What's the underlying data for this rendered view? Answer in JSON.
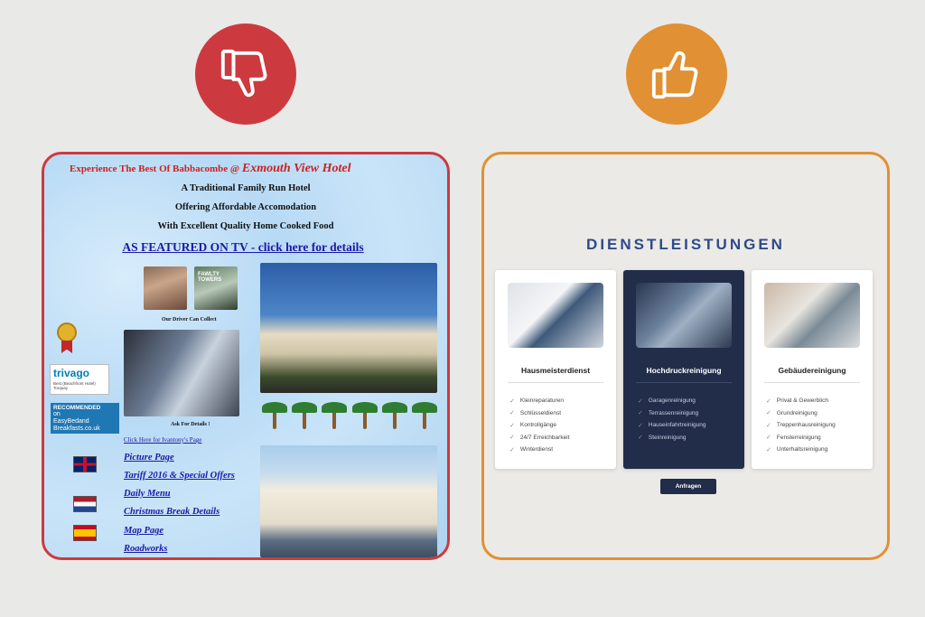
{
  "colors": {
    "bad": "#cc3a3f",
    "good": "#e19033",
    "old_link": "#1a1aa8",
    "new_title": "#2e4a8a",
    "new_dark": "#222d4a"
  },
  "bad_badge": {
    "icon": "thumbs-down-icon"
  },
  "good_badge": {
    "icon": "thumbs-up-icon"
  },
  "old_site": {
    "top_prefix": "Experience The Best Of Babbacombe @",
    "hotel_name": "Exmouth View Hotel",
    "lines": [
      "A Traditional Family Run Hotel",
      "Offering Affordable Accomodation",
      "With Excellent Quality Home Cooked Food"
    ],
    "tv_link": "AS FEATURED ON TV - click here for details",
    "fawlty_sign": "FAWLTY TOWERS",
    "driver_caption": "Our Driver Can Collect",
    "ask_caption": "Ask For Details !",
    "trivago": {
      "logo": "trivago",
      "sub": "Best (Beachfront Hotel) Torquay"
    },
    "recommended": {
      "title": "RECOMMENDED",
      "on": "on",
      "site": "EasyBedand Breakfasts.co.uk"
    },
    "ivantony_link": "Click Here for Ivantony's Page",
    "nav_links": [
      "Picture Page",
      "Tariff 2016 & Special Offers",
      "Daily Menu",
      "Christmas Break Details",
      "Map Page",
      "Roadworks"
    ]
  },
  "new_site": {
    "title": "DIENSTLEISTUNGEN",
    "services": [
      {
        "name": "Hausmeisterdienst",
        "items": [
          "Kleinreparaturen",
          "Schlüsseldienst",
          "Kontrollgänge",
          "24/7 Erreichbarkeit",
          "Winterdienst"
        ]
      },
      {
        "name": "Hochdruckreinigung",
        "items": [
          "Garagenreinigung",
          "Terrassenreinigung",
          "Hauseinfahrtreinigung",
          "Steinreinigung"
        ]
      },
      {
        "name": "Gebäudereinigung",
        "items": [
          "Privat & Gewerblich",
          "Grundreinigung",
          "Treppenhausreinigung",
          "Fensterreinigung",
          "Unterhaltsreinigung"
        ]
      }
    ],
    "cta": "Anfragen"
  }
}
